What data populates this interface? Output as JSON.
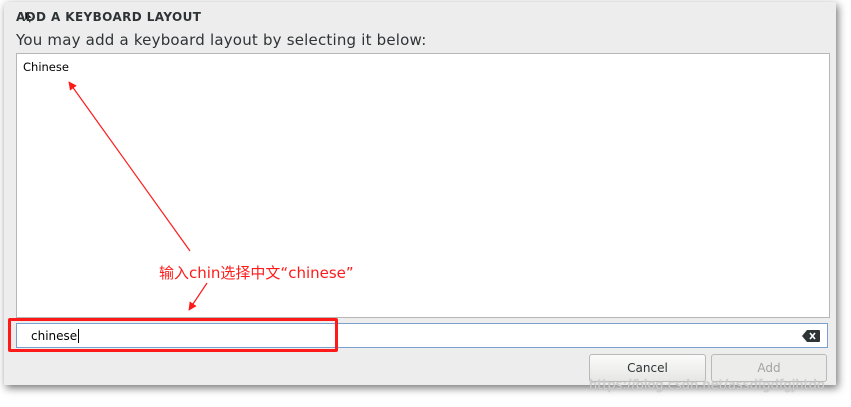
{
  "dialog": {
    "title": "ADD A KEYBOARD LAYOUT",
    "subtitle": "You may add a keyboard layout by selecting it below:"
  },
  "list": {
    "items": [
      {
        "label": "Chinese"
      }
    ]
  },
  "search": {
    "value": "chinese",
    "clear_icon": "backspace-clear-icon"
  },
  "buttons": {
    "cancel": "Cancel",
    "add": "Add"
  },
  "annotation": {
    "text": "输入chin选择中文“chinese”",
    "color": "#ff1a1a"
  },
  "watermark": {
    "text": "https://blog.csdn.net/assdfgdfgjhtdo"
  }
}
